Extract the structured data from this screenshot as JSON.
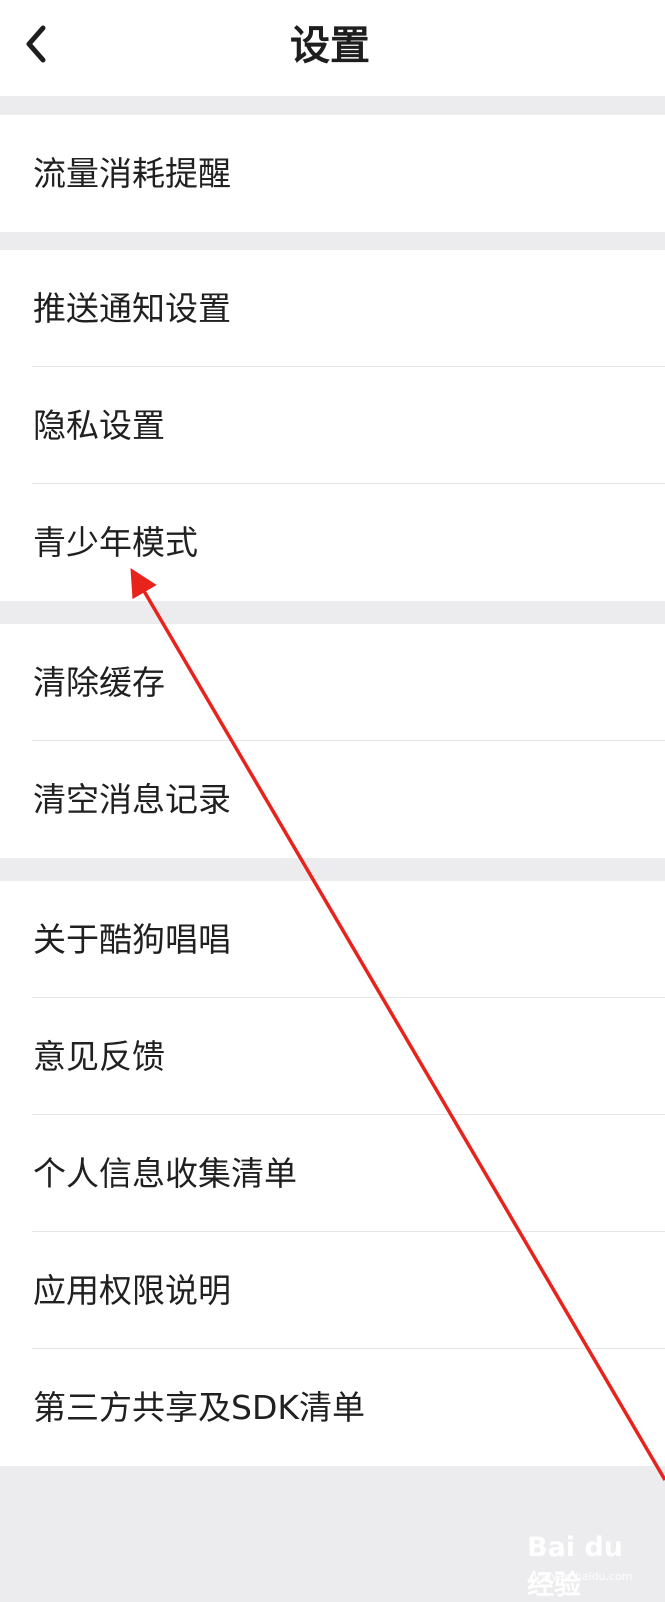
{
  "header": {
    "back_icon": "chevron-left-icon",
    "title": "设置"
  },
  "groups": [
    {
      "items": [
        {
          "label": "流量消耗提醒"
        }
      ]
    },
    {
      "items": [
        {
          "label": "推送通知设置"
        },
        {
          "label": "隐私设置"
        },
        {
          "label": "青少年模式"
        }
      ]
    },
    {
      "items": [
        {
          "label": "清除缓存"
        },
        {
          "label": "清空消息记录"
        }
      ]
    },
    {
      "items": [
        {
          "label": "关于酷狗唱唱"
        },
        {
          "label": "意见反馈"
        },
        {
          "label": "个人信息收集清单"
        },
        {
          "label": "应用权限说明"
        },
        {
          "label": "第三方共享及SDK清单"
        }
      ]
    }
  ],
  "annotation": {
    "color": "#e8231c"
  },
  "watermark": {
    "brand": "Bai du 经验",
    "url": "jingyan.baidu.com"
  }
}
